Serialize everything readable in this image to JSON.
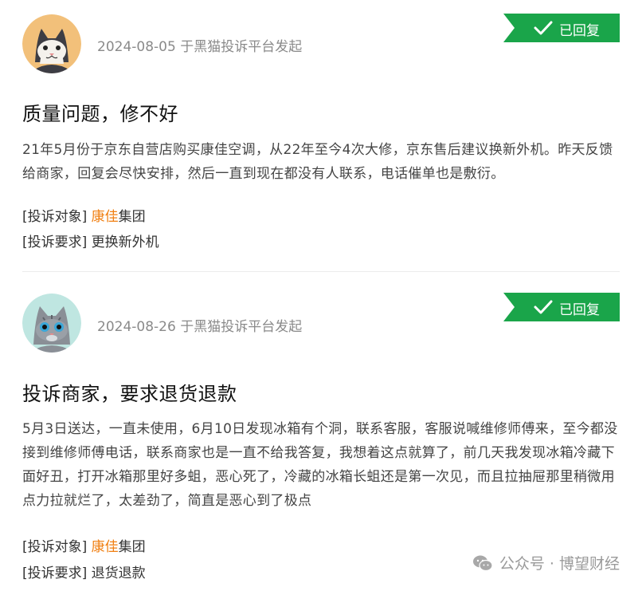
{
  "complaints": [
    {
      "date_source": "2024-08-05 于黑猫投诉平台发起",
      "status": "已回复",
      "title": "质量问题，修不好",
      "description": "21年5月份于京东自营店购买康佳空调，从22年至今4次大修，京东售后建议换新外机。昨天反馈给商家，回复会尽快安排，然后一直到现在都没有人联系，电话催单也是敷衍。",
      "target_label": "[投诉对象]",
      "target_brand": "康佳",
      "target_rest": "集团",
      "request_label": "[投诉要求]",
      "request_value": "更换新外机"
    },
    {
      "date_source": "2024-08-26 于黑猫投诉平台发起",
      "status": "已回复",
      "title": "投诉商家，要求退货退款",
      "description": "5月3日送达，一直未使用，6月10日发现冰箱有个洞，联系客服，客服说喊维修师傅来，至今都没接到维修师傅电话，联系商家也是一直不给我答复，我想着这点就算了，前几天我发现冰箱冷藏下面好丑，打开冰箱那里好多蛆，恶心死了，冷藏的冰箱长蛆还是第一次见，而且拉抽屉那里稍微用点力拉就烂了，太差劲了，简直是恶心到了极点",
      "target_label": "[投诉对象]",
      "target_brand": "康佳",
      "target_rest": "集团",
      "request_label": "[投诉要求]",
      "request_value": "退货退款"
    }
  ],
  "watermark": "公众号 · 博望财经",
  "colors": {
    "badge_green": "#1aa54a",
    "brand_orange": "#f07f12"
  },
  "icons": {
    "avatar1": "cat-avatar-orange",
    "avatar2": "cat-avatar-gray",
    "status": "check-icon",
    "watermark": "wechat-icon"
  }
}
